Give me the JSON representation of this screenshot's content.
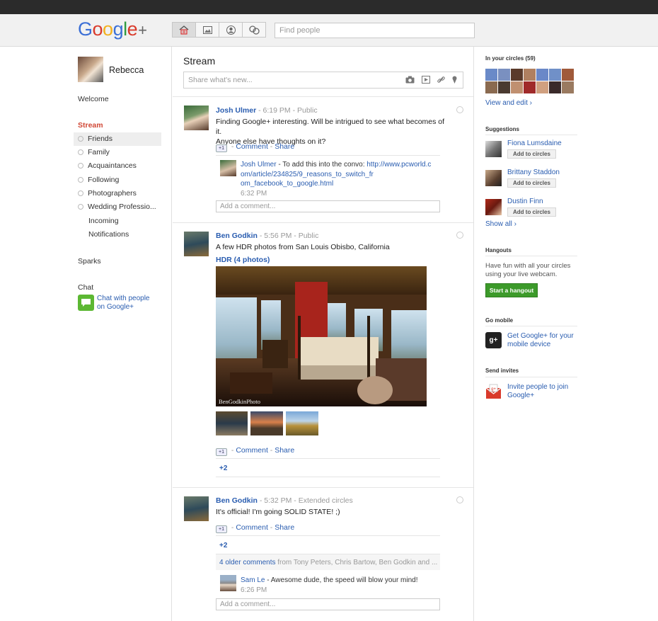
{
  "header": {
    "logo": "Google",
    "logo_plus": "+",
    "search_placeholder": "Find people",
    "nav_icons": [
      "home-icon",
      "photos-icon",
      "profile-icon",
      "circles-icon"
    ]
  },
  "sidebar": {
    "user_name": "Rebecca",
    "welcome": "Welcome",
    "stream": "Stream",
    "circles": [
      {
        "label": "Friends",
        "selected": true
      },
      {
        "label": "Family"
      },
      {
        "label": "Acquaintances"
      },
      {
        "label": "Following"
      },
      {
        "label": "Photographers"
      },
      {
        "label": "Wedding Professio..."
      }
    ],
    "incoming": "Incoming",
    "notifications": "Notifications",
    "sparks": "Sparks",
    "chat_heading": "Chat",
    "chat_link_1": "Chat with people",
    "chat_link_2": "on Google+"
  },
  "stream": {
    "title": "Stream",
    "share_placeholder": "Share what's new...",
    "share_icons": [
      "camera-icon",
      "video-icon",
      "link-icon",
      "location-icon"
    ]
  },
  "posts": [
    {
      "author": "Josh Ulmer",
      "time": "6:19 PM",
      "visibility": "Public",
      "text_1": "Finding Google+ interesting. Will be intrigued to see what becomes of it.",
      "text_2": "Anyone else have thoughts on it?",
      "plus_one": "+1",
      "comment": "Comment",
      "share": "Share",
      "comment_author": "Josh Ulmer",
      "comment_text": " - To add this into the convo: ",
      "comment_link_1": "http://www.pcworld.c",
      "comment_link_2": "om/article/234825/9_reasons_to_switch_fr",
      "comment_link_3": "om_facebook_to_google.html",
      "comment_time": "6:32 PM",
      "add_comment": "Add a comment..."
    },
    {
      "author": "Ben Godkin",
      "time": "5:56 PM",
      "visibility": "Public",
      "text": "A few HDR photos from San Louis Obisbo, California",
      "album": "HDR (4 photos)",
      "watermark": "BenGodkinPhoto",
      "plus_one": "+1",
      "comment": "Comment",
      "share": "Share",
      "plus_count": "+2"
    },
    {
      "author": "Ben Godkin",
      "time": "5:32 PM",
      "visibility": "Extended circles",
      "text": "It's official! I'm going SOLID STATE! ;)",
      "plus_one": "+1",
      "comment": "Comment",
      "share": "Share",
      "plus_count": "+2",
      "older_comments": "4 older comments",
      "older_from": " from Tony Peters, Chris Bartow, Ben Godkin and ...",
      "comment_author": "Sam Le",
      "comment_text": " - Awesome dude, the speed will blow your mind!",
      "comment_time": "6:26 PM",
      "add_comment": "Add a comment..."
    }
  ],
  "right": {
    "circles_title": "In your circles (59)",
    "view_edit": "View and edit ›",
    "suggestions_title": "Suggestions",
    "suggestions": [
      {
        "name": "Fiona Lumsdaine",
        "button": "Add to circles"
      },
      {
        "name": "Brittany Staddon",
        "button": "Add to circles"
      },
      {
        "name": "Dustin Finn",
        "button": "Add to circles"
      }
    ],
    "show_all": "Show all ›",
    "hangouts_title": "Hangouts",
    "hangouts_text_1": "Have fun with all your circles",
    "hangouts_text_2": "using your live webcam.",
    "hangout_button": "Start a hangout",
    "mobile_title": "Go mobile",
    "mobile_link_1": "Get Google+ for your",
    "mobile_link_2": "mobile device",
    "invites_title": "Send invites",
    "invite_link_1": "Invite people to join",
    "invite_link_2": "Google+"
  }
}
